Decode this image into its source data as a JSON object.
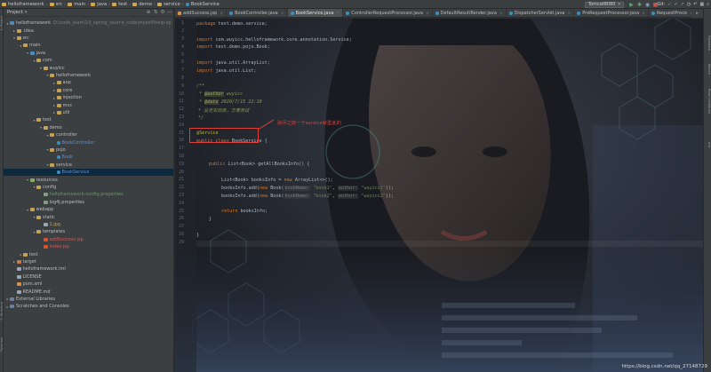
{
  "breadcrumb": [
    "helloframework",
    "src",
    "main",
    "java",
    "test",
    "demo",
    "service",
    "BookService"
  ],
  "run": {
    "config": "Tomcat8080"
  },
  "git": {
    "label": "Git:"
  },
  "project_panel": {
    "title": "Project",
    "tree": [
      {
        "label": "helloframework",
        "path": "D:\\code_learn\\10_spring_source_code\\myself\\help-sp",
        "depth": 0,
        "arrow": "▾",
        "icon": "folder blue"
      },
      {
        "label": ".idea",
        "depth": 1,
        "arrow": "▸",
        "icon": "folder"
      },
      {
        "label": "src",
        "depth": 1,
        "arrow": "▾",
        "icon": "folder"
      },
      {
        "label": "main",
        "depth": 2,
        "arrow": "▾",
        "icon": "folder"
      },
      {
        "label": "java",
        "depth": 3,
        "arrow": "▾",
        "icon": "folder blue"
      },
      {
        "label": "com",
        "depth": 4,
        "arrow": "▾",
        "icon": "folder"
      },
      {
        "label": "wuyicc",
        "depth": 5,
        "arrow": "▾",
        "icon": "folder"
      },
      {
        "label": "helloframework",
        "depth": 6,
        "arrow": "▾",
        "icon": "folder"
      },
      {
        "label": "aop",
        "depth": 7,
        "arrow": "▸",
        "icon": "folder"
      },
      {
        "label": "core",
        "depth": 7,
        "arrow": "▸",
        "icon": "folder"
      },
      {
        "label": "injection",
        "depth": 7,
        "arrow": "▸",
        "icon": "folder"
      },
      {
        "label": "mvc",
        "depth": 7,
        "arrow": "▸",
        "icon": "folder"
      },
      {
        "label": "util",
        "depth": 7,
        "arrow": "▸",
        "icon": "folder"
      },
      {
        "label": "test",
        "depth": 4,
        "arrow": "▾",
        "icon": "folder"
      },
      {
        "label": "demo",
        "depth": 5,
        "arrow": "▾",
        "icon": "folder"
      },
      {
        "label": "controller",
        "depth": 6,
        "arrow": "▾",
        "icon": "folder"
      },
      {
        "label": "BookController",
        "depth": 7,
        "arrow": "",
        "icon": "cls",
        "style": "cls-name"
      },
      {
        "label": "pojo",
        "depth": 6,
        "arrow": "▾",
        "icon": "folder"
      },
      {
        "label": "Book",
        "depth": 7,
        "arrow": "",
        "icon": "cls",
        "style": "cls-name"
      },
      {
        "label": "service",
        "depth": 6,
        "arrow": "▾",
        "icon": "folder"
      },
      {
        "label": "BookService",
        "depth": 7,
        "arrow": "",
        "icon": "cls",
        "style": "cls-name",
        "selected": true
      },
      {
        "label": "resources",
        "depth": 3,
        "arrow": "▾",
        "icon": "folder res"
      },
      {
        "label": "config",
        "depth": 4,
        "arrow": "▾",
        "icon": "folder"
      },
      {
        "label": "helloframework-config.properties",
        "depth": 5,
        "arrow": "",
        "icon": "prop",
        "style": "green"
      },
      {
        "label": "log4j.properties",
        "depth": 5,
        "arrow": "",
        "icon": "prop"
      },
      {
        "label": "webapp",
        "depth": 3,
        "arrow": "▾",
        "icon": "folder"
      },
      {
        "label": "static",
        "depth": 4,
        "arrow": "▾",
        "icon": "folder"
      },
      {
        "label": "1.jpg",
        "depth": 5,
        "arrow": "",
        "icon": "file",
        "style": "yellow"
      },
      {
        "label": "templates",
        "depth": 4,
        "arrow": "▾",
        "icon": "folder"
      },
      {
        "label": "addSuccess.jsp",
        "depth": 5,
        "arrow": "",
        "icon": "html",
        "style": "err"
      },
      {
        "label": "index.jsp",
        "depth": 5,
        "arrow": "",
        "icon": "html",
        "style": "err"
      },
      {
        "label": "test",
        "depth": 2,
        "arrow": "▸",
        "icon": "folder"
      },
      {
        "label": "target",
        "depth": 1,
        "arrow": "▸",
        "icon": "folder excl"
      },
      {
        "label": "helloframework.iml",
        "depth": 1,
        "arrow": "",
        "icon": "file"
      },
      {
        "label": "LICENSE",
        "depth": 1,
        "arrow": "",
        "icon": "file"
      },
      {
        "label": "pom.xml",
        "depth": 1,
        "arrow": "",
        "icon": "xml"
      },
      {
        "label": "README.md",
        "depth": 1,
        "arrow": "",
        "icon": "file"
      },
      {
        "label": "External Libraries",
        "depth": 0,
        "arrow": "▸",
        "icon": "lib"
      },
      {
        "label": "Scratches and Consoles",
        "depth": 0,
        "arrow": "▸",
        "icon": "lib"
      }
    ]
  },
  "tabs": [
    {
      "label": "addSuccess.jsp",
      "type": "jsp"
    },
    {
      "label": "BookController.java",
      "type": "cls"
    },
    {
      "label": "BookService.java",
      "type": "cls",
      "active": true
    },
    {
      "label": "ControllerRequestProcessor.java",
      "type": "cls"
    },
    {
      "label": "DefaultResultRender.java",
      "type": "cls"
    },
    {
      "label": "DispatcherServlet.java",
      "type": "cls"
    },
    {
      "label": "PreRequestProcessor.java",
      "type": "cls"
    },
    {
      "label": "RequestProce",
      "type": "cls"
    }
  ],
  "editor": {
    "line_numbers": [
      "1",
      "2",
      "3",
      "4",
      "5",
      "6",
      "7",
      "8",
      "9",
      "10",
      "11",
      "12",
      "13",
      "14",
      "15",
      "16",
      "17",
      "18",
      "19",
      "20",
      "21",
      "22",
      "23",
      "24",
      "25",
      "26",
      "27",
      "28",
      "29"
    ],
    "code": {
      "l1_kw": "package",
      "l1_rest": " test.demo.service;",
      "l3_kw": "import",
      "l3_rest": " com.wuyicc.helloframework.core.annotation.Service;",
      "l4_kw": "import",
      "l4_rest": " test.demo.pojo.Book;",
      "l6_kw": "import",
      "l6_rest": " java.util.ArrayList;",
      "l7_kw": "import",
      "l7_rest": " java.util.List;",
      "l9": "/**",
      "l10_tag": "@author",
      "l10_rest": " wuyicc",
      "l11_tag": "@date",
      "l11_rest": " 2020/7/15 22:10",
      "l12": "* 业务实现类，方便测试",
      "l13": "*/",
      "l15": "@Service",
      "l16_kw": "public class",
      "l16_rest": " BookService {",
      "l18_kw": "public",
      "l18_rest": " List<Book> getAllBooksInfo() {",
      "l20_a": "List<Book> booksInfo = ",
      "l20_kw": "new",
      "l20_b": " ArrayList<>();",
      "l21_a": "booksInfo.add(",
      "l21_kw": "new",
      "l21_b": " Book(",
      "l21_h1": "bookName:",
      "l21_s1": "\"book1\"",
      "l21_c": ", ",
      "l21_h2": "author:",
      "l21_s2": "\"wuyicc1\"",
      "l21_e": "));",
      "l22_a": "booksInfo.add(",
      "l22_kw": "new",
      "l22_b": " Book(",
      "l22_h1": "bookName:",
      "l22_s1": "\"book2\"",
      "l22_c": ", ",
      "l22_h2": "author:",
      "l22_s2": "\"wuyicc2\"",
      "l22_e": "));",
      "l24_kw": "return",
      "l24_rest": " booksInfo;",
      "l25": "}",
      "l27": "}"
    },
    "annotation": "别问之前一个service就型此的"
  },
  "left_strip": [
    "1: Project",
    "7: Structure",
    "Favorites"
  ],
  "right_strip": [
    "Database",
    "Maven",
    "Bean Validation",
    "Ant"
  ],
  "watermark": "https://blog.csdn.net/qq_27148729"
}
